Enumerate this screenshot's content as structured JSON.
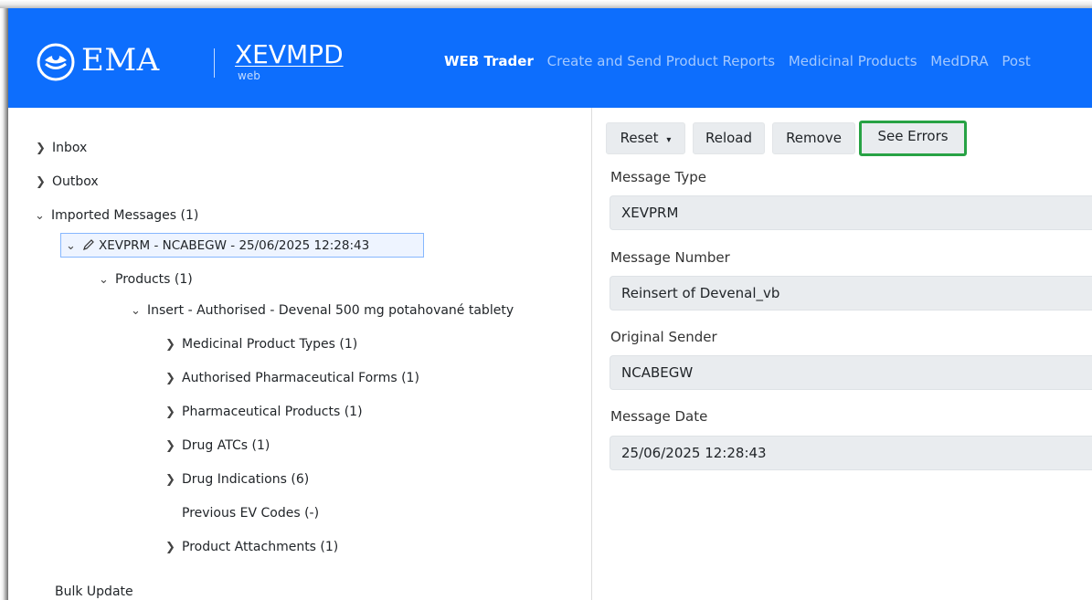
{
  "header": {
    "logo_text": "EMA",
    "product": "XEVMPD",
    "product_sub": "web",
    "nav": [
      {
        "label": "WEB Trader",
        "active": true
      },
      {
        "label": "Create and Send Product Reports",
        "active": false
      },
      {
        "label": "Medicinal Products",
        "active": false
      },
      {
        "label": "MedDRA",
        "active": false
      },
      {
        "label": "Post",
        "active": false
      }
    ]
  },
  "tree": {
    "inbox": "Inbox",
    "outbox": "Outbox",
    "imported": "Imported Messages (1)",
    "message": "XEVPRM - NCABEGW - 25/06/2025 12:28:43",
    "products": "Products (1)",
    "product": "Insert - Authorised - Devenal 500 mg potahované tablety",
    "children": [
      "Medicinal Product Types (1)",
      "Authorised Pharmaceutical Forms (1)",
      "Pharmaceutical Products (1)",
      "Drug ATCs (1)",
      "Drug Indications (6)",
      "Previous EV Codes (-)",
      "Product Attachments (1)"
    ],
    "bulk_update": "Bulk Update"
  },
  "toolbar": {
    "reset": "Reset",
    "reload": "Reload",
    "remove": "Remove",
    "see_errors": "See Errors"
  },
  "details": {
    "message_type_label": "Message Type",
    "message_type": "XEVPRM",
    "message_number_label": "Message Number",
    "message_number": "Reinsert of Devenal_vb",
    "original_sender_label": "Original Sender",
    "original_sender": "NCABEGW",
    "message_date_label": "Message Date",
    "message_date": "25/06/2025 12:28:43"
  },
  "colors": {
    "header_bg": "#0d6efd",
    "highlight": "#27a244"
  }
}
